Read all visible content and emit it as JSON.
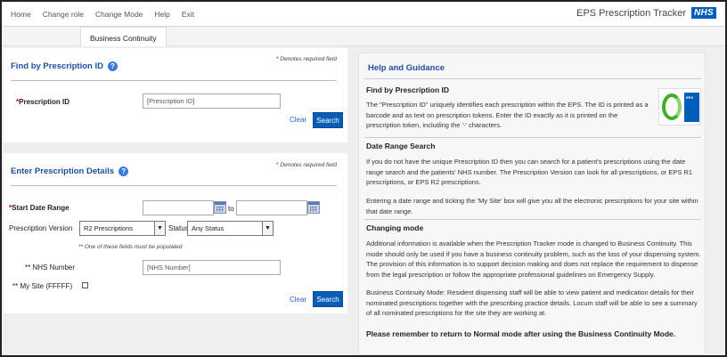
{
  "nav": {
    "items": [
      "Home",
      "Change role",
      "Change Mode",
      "Help",
      "Exit"
    ]
  },
  "brand": {
    "title": "EPS Prescription Tracker",
    "logo": "NHS"
  },
  "tab": {
    "label": "Business Continuity"
  },
  "find_panel": {
    "title": "Find by Prescription ID",
    "required_note": "Denotes required field",
    "prescription_id_label": "Prescription ID",
    "prescription_id_placeholder": "[Prescription ID]",
    "clear": "Clear",
    "search": "Search"
  },
  "details_panel": {
    "title": "Enter Prescription Details",
    "required_note": "Denotes required field",
    "start_date_label": "Start Date Range",
    "to_label": "to",
    "version_label": "Prescription Version",
    "version_value": "R2 Prescriptions",
    "status_label": "Status",
    "status_value": "Any Status",
    "fields_note": "** One of these fields must be populated",
    "nhs_label": "** NHS Number",
    "nhs_placeholder": "[NHS Number]",
    "my_site_label": "** My Site (FFFFF)",
    "clear": "Clear",
    "search": "Search"
  },
  "help": {
    "title": "Help and Guidance",
    "logo_text": "EPS",
    "sections": [
      {
        "heading": "Find by Prescription ID",
        "paragraphs": [
          "The \"Prescription ID\" uniquely identifies each prescription within the EPS. The ID is printed as a barcode and as text on prescription tokens. Enter the ID exactly as it is printed on the prescription token, including the '-' characters."
        ]
      },
      {
        "heading": "Date Range Search",
        "paragraphs": [
          "If you do not have the unique Prescription ID then you can search for a patient's prescriptions using the date range search and the patients' NHS number. The Prescription Version can look for all prescriptions, or EPS R1 prescriptions, or EPS R2 prescriptions.",
          "Entering a date range and ticking the 'My Site' box will give you all the electronic prescriptions for your site within that date range."
        ]
      },
      {
        "heading": "Changing mode",
        "paragraphs": [
          "Additional information is available when the Prescription Tracker mode is changed to Business Continuity. This mode should only be used if you have a business continuity problem, such as the loss of your dispensing system. The provision of this information is to support decision making and does not replace the requirement to dispense from the legal prescription or follow the appropriate professional guidelines on Emergency Supply.",
          "Business Continuity Mode: Resident dispensing staff will be able to view patient and medication details for their nominated prescriptions together with the prescribing practice details. Locum staff will be able to see a summary of all nominated prescriptions for the site they are working at."
        ]
      }
    ],
    "reminder": "Please remember to return to Normal mode after using the Business Continuity Mode."
  }
}
